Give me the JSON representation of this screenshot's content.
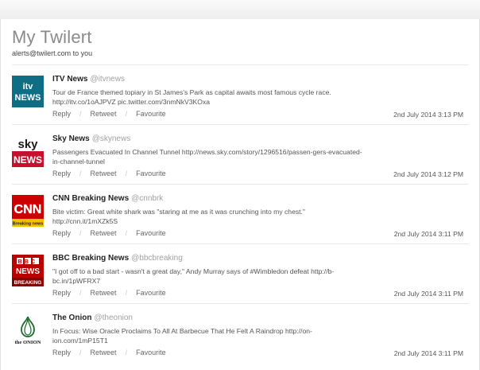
{
  "page": {
    "title": "My Twilert",
    "sender": "alerts@twilert.com",
    "recipient_suffix": "to you"
  },
  "colors": {
    "itv": "#0f6e84",
    "sky": "#c8102e",
    "cnn": "#cc0000",
    "bbc": "#b80000",
    "onion": "#1a6a2a"
  },
  "actions": {
    "reply": "Reply",
    "retweet": "Retweet",
    "favourite": "Favourite"
  },
  "tweets": [
    {
      "name": "ITV News",
      "handle": "@itvnews",
      "logo": "itv-news-logo",
      "logo_text": [
        "itv",
        "NEWS"
      ],
      "text": "Tour de France themed topiary in St James's Park as capital awaits most famous cycle race. http://itv.co/1oAJPVZ pic.twitter.com/3nmNkV3KOxa",
      "time": "2nd July 2014 3:13 PM"
    },
    {
      "name": "Sky News",
      "handle": "@skynews",
      "logo": "sky-news-logo",
      "logo_text": [
        "sky",
        "NEWS"
      ],
      "text": "Passengers Evacuated In Channel Tunnel http://news.sky.com/story/1296516/passen-gers-evacuated-in-channel-tunnel",
      "time": "2nd July 2014 3:12 PM"
    },
    {
      "name": "CNN Breaking News",
      "handle": "@cnnbrk",
      "logo": "cnn-logo",
      "logo_text": [
        "CNN",
        "Breaking news"
      ],
      "text": "Bite victim: Great white shark was \"staring at me as it was crunching into my chest.\" http://cnn.it/1mXZk5S",
      "time": "2nd July 2014 3:11 PM"
    },
    {
      "name": "BBC Breaking News",
      "handle": "@bbcbreaking",
      "logo": "bbc-breaking-logo",
      "logo_text": [
        "BBC",
        "NEWS",
        "BREAKING"
      ],
      "text": "\"I got off to a bad start - wasn't a great day,\" Andy Murray says of #Wimbledon defeat http://b-bc.in/1pWFRX7",
      "time": "2nd July 2014 3:11 PM"
    },
    {
      "name": "The Onion",
      "handle": "@theonion",
      "logo": "onion-logo",
      "logo_text": [
        "the ONION"
      ],
      "text": "In Focus: Wise Oracle Proclaims To All At Barbecue That He Felt A Raindrop http://on-ion.com/1mP15T1",
      "time": "2nd July 2014 3:11 PM"
    }
  ]
}
